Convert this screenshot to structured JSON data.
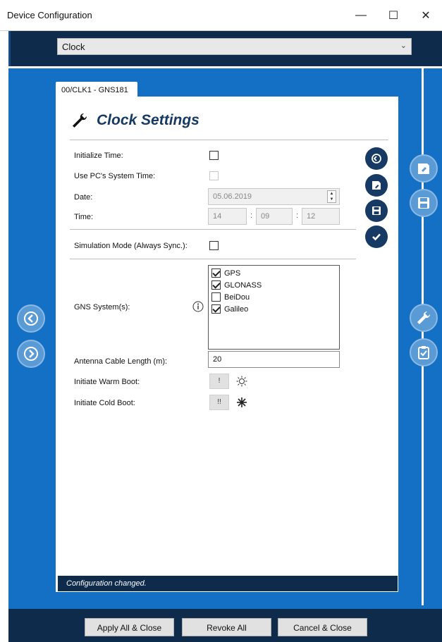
{
  "window": {
    "title": "Device Configuration",
    "minimize": "—",
    "maximize": "☐",
    "close": "✕"
  },
  "device_select": {
    "value": "Clock",
    "arrow": "⌄"
  },
  "tab": {
    "label": "00/CLK1 - GNS181"
  },
  "page": {
    "title": "Clock Settings"
  },
  "form": {
    "initialize_time_label": "Initialize Time:",
    "initialize_time_checked": false,
    "use_pc_time_label": "Use PC's System Time:",
    "use_pc_time_checked": false,
    "date_label": "Date:",
    "date_value": "05.06.2019",
    "time_label": "Time:",
    "time_hour": "14",
    "time_minute": "09",
    "time_second": "12",
    "time_sep": ":",
    "simulation_label": "Simulation Mode (Always Sync.):",
    "simulation_checked": false,
    "gns_label": "GNS System(s):",
    "gns_systems": [
      {
        "name": "GPS",
        "checked": true
      },
      {
        "name": "GLONASS",
        "checked": true
      },
      {
        "name": "BeiDou",
        "checked": false
      },
      {
        "name": "Galileo",
        "checked": true
      }
    ],
    "antenna_label": "Antenna Cable Length (m):",
    "antenna_value": "20",
    "warm_boot_label": "Initiate Warm Boot:",
    "warm_boot_button": "!",
    "cold_boot_label": "Initiate Cold Boot:",
    "cold_boot_button": "!!"
  },
  "status": {
    "text": "Configuration changed."
  },
  "footer": {
    "apply_all": "Apply All & Close",
    "revoke_all": "Revoke All",
    "cancel": "Cancel & Close"
  },
  "colors": {
    "accent_blue": "#1470c4",
    "navy": "#0f2b4c",
    "icon_navy": "#163a63"
  },
  "icons": [
    "wrench-icon",
    "revert-icon",
    "load-icon",
    "save-icon",
    "checkmark-icon",
    "info-icon",
    "sun-icon",
    "snowflake-icon",
    "back-icon",
    "forward-icon",
    "clipboard-icon"
  ]
}
